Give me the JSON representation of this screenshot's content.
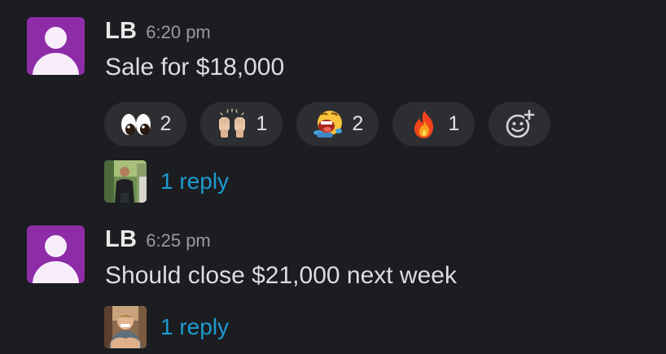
{
  "messages": [
    {
      "author": "LB",
      "time": "6:20 pm",
      "text": "Sale for $18,000",
      "reactions": [
        {
          "emoji": "eyes-emoji",
          "count": "2"
        },
        {
          "emoji": "raised-hands-emoji",
          "count": "1"
        },
        {
          "emoji": "laughing-emoji",
          "count": "2"
        },
        {
          "emoji": "fire-emoji",
          "count": "1"
        }
      ],
      "add_reaction_icon": "add-reaction-icon",
      "reply_text": "1 reply"
    },
    {
      "author": "LB",
      "time": "6:25 pm",
      "text": "Should close $21,000 next week",
      "reply_text": "1 reply"
    }
  ],
  "colors": {
    "background": "#1b1d21",
    "avatar": "#8e2ca8",
    "link": "#1d9bd1",
    "reaction_pill": "#2c2e32"
  }
}
